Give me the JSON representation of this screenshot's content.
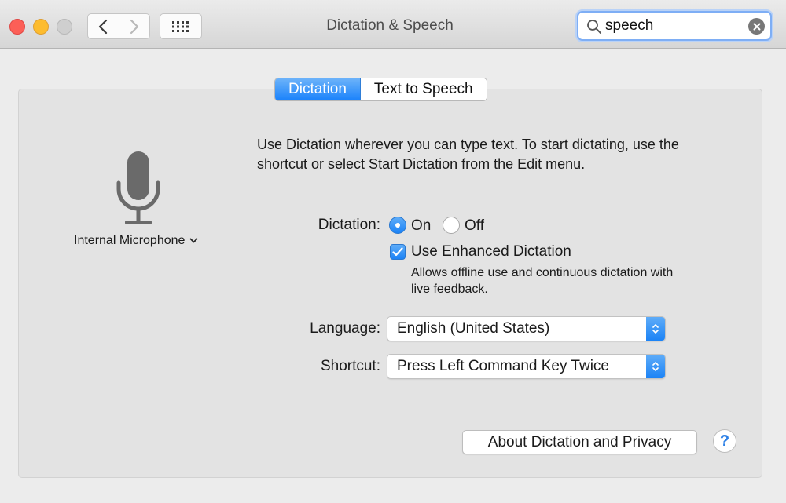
{
  "window": {
    "title": "Dictation & Speech",
    "traffic_lights": [
      "close",
      "minimize",
      "zoom"
    ],
    "search": {
      "value": "speech",
      "icon": "magnifier-icon"
    }
  },
  "tabs": [
    {
      "label": "Dictation",
      "active": true
    },
    {
      "label": "Text to Speech",
      "active": false
    }
  ],
  "microphone": {
    "icon": "microphone-icon",
    "source_label": "Internal Microphone"
  },
  "description": "Use Dictation wherever you can type text. To start dictating, use the shortcut or select Start Dictation from the Edit menu.",
  "dictation": {
    "label": "Dictation:",
    "options": [
      {
        "label": "On",
        "selected": true
      },
      {
        "label": "Off",
        "selected": false
      }
    ],
    "enhanced": {
      "label": "Use Enhanced Dictation",
      "checked": true,
      "help": "Allows offline use and continuous dictation with live feedback."
    }
  },
  "language": {
    "label": "Language:",
    "value": "English (United States)"
  },
  "shortcut": {
    "label": "Shortcut:",
    "value": "Press Left Command Key Twice"
  },
  "buttons": {
    "about": "About Dictation and Privacy",
    "help": "?"
  },
  "colors": {
    "accent": "#1c83f6",
    "close": "#fc5f57",
    "minimize": "#fdbc2e",
    "zoom_disabled": "#cfcfcf"
  }
}
